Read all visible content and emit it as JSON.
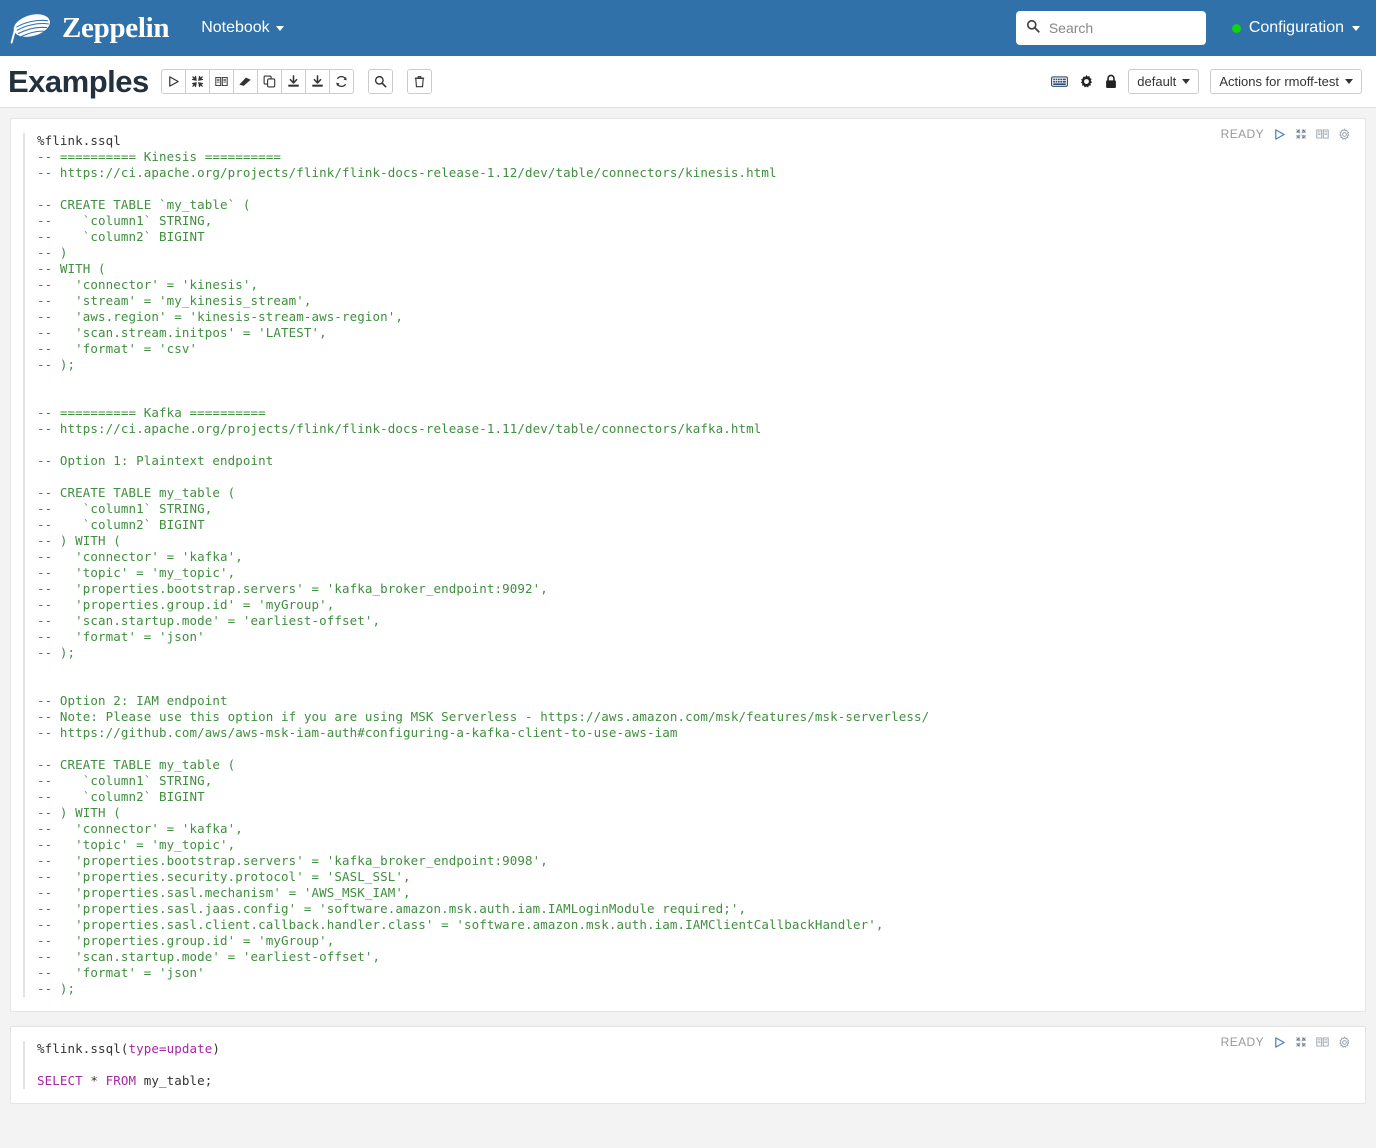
{
  "navbar": {
    "brand_name": "Zeppelin",
    "brand_logo_icon": "zeppelin-logo-icon",
    "notebook_menu_label": "Notebook",
    "search": {
      "placeholder": "Search",
      "value": "",
      "icon": "search-icon"
    },
    "configuration_label": "Configuration",
    "status_dot_color": "#0fd40f",
    "background_color": "#3071a9"
  },
  "note_toolbar": {
    "title": "Examples",
    "buttons": [
      {
        "name": "run-all-paragraphs-button",
        "icon": "play-icon",
        "title": "Run all paragraphs"
      },
      {
        "name": "toggle-all-collapse-button",
        "icon": "collapse-icon",
        "title": "Show/hide the code"
      },
      {
        "name": "toggle-all-output-button",
        "icon": "book-icon",
        "title": "Show/hide the output"
      },
      {
        "name": "clear-output-button",
        "icon": "eraser-icon",
        "title": "Clear output"
      },
      {
        "name": "clone-note-button",
        "icon": "copy-icon",
        "title": "Clone the notebook"
      },
      {
        "name": "export-note-button",
        "icon": "download-icon",
        "title": "Export the notebook"
      },
      {
        "name": "import-note-button",
        "icon": "download-alt-icon",
        "title": "Import the notebook"
      },
      {
        "name": "reload-note-button",
        "icon": "refresh-icon",
        "title": "Reload from storage"
      }
    ],
    "search_button": {
      "name": "search-code-button",
      "icon": "search-icon"
    },
    "trash_button": {
      "name": "move-to-trash-button",
      "icon": "trash-icon"
    },
    "keyboard_icon": "keyboard-icon",
    "settings_icon": "gear-icon",
    "lock_icon": "lock-icon",
    "interpreter_binding_label": "default",
    "actions_label": "Actions for rmoff-test"
  },
  "paragraphs": [
    {
      "id": "paragraph-1",
      "status": "READY",
      "controls": [
        {
          "name": "run-paragraph-button",
          "icon": "play-icon"
        },
        {
          "name": "hide-editor-button",
          "icon": "collapse-icon"
        },
        {
          "name": "hide-output-button",
          "icon": "book-icon"
        },
        {
          "name": "paragraph-settings-button",
          "icon": "gear-icon"
        }
      ],
      "code_lines": [
        [
          {
            "t": "%flink.ssql",
            "c": "par"
          }
        ],
        [
          {
            "t": "-- ========== Kinesis ==========",
            "c": "cmt"
          }
        ],
        [
          {
            "t": "-- https://ci.apache.org/projects/flink/flink-docs-release-1.12/dev/table/connectors/kinesis.html",
            "c": "cmt"
          }
        ],
        [
          {
            "t": "",
            "c": "par"
          }
        ],
        [
          {
            "t": "-- CREATE TABLE `my_table` (",
            "c": "cmt"
          }
        ],
        [
          {
            "t": "--    `column1` STRING,",
            "c": "cmt"
          }
        ],
        [
          {
            "t": "--    `column2` BIGINT",
            "c": "cmt"
          }
        ],
        [
          {
            "t": "-- )",
            "c": "cmt"
          }
        ],
        [
          {
            "t": "-- WITH (",
            "c": "cmt"
          }
        ],
        [
          {
            "t": "--   'connector' = 'kinesis',",
            "c": "cmt"
          }
        ],
        [
          {
            "t": "--   'stream' = 'my_kinesis_stream',",
            "c": "cmt"
          }
        ],
        [
          {
            "t": "--   'aws.region' = 'kinesis-stream-aws-region',",
            "c": "cmt"
          }
        ],
        [
          {
            "t": "--   'scan.stream.initpos' = 'LATEST',",
            "c": "cmt"
          }
        ],
        [
          {
            "t": "--   'format' = 'csv'",
            "c": "cmt"
          }
        ],
        [
          {
            "t": "-- );",
            "c": "cmt"
          }
        ],
        [
          {
            "t": "",
            "c": "par"
          }
        ],
        [
          {
            "t": "",
            "c": "par"
          }
        ],
        [
          {
            "t": "-- ========== Kafka ==========",
            "c": "cmt"
          }
        ],
        [
          {
            "t": "-- https://ci.apache.org/projects/flink/flink-docs-release-1.11/dev/table/connectors/kafka.html",
            "c": "cmt"
          }
        ],
        [
          {
            "t": "",
            "c": "par"
          }
        ],
        [
          {
            "t": "-- Option 1: Plaintext endpoint",
            "c": "cmt"
          }
        ],
        [
          {
            "t": "",
            "c": "par"
          }
        ],
        [
          {
            "t": "-- CREATE TABLE my_table (",
            "c": "cmt"
          }
        ],
        [
          {
            "t": "--    `column1` STRING,",
            "c": "cmt"
          }
        ],
        [
          {
            "t": "--    `column2` BIGINT",
            "c": "cmt"
          }
        ],
        [
          {
            "t": "-- ) WITH (",
            "c": "cmt"
          }
        ],
        [
          {
            "t": "--   'connector' = 'kafka',",
            "c": "cmt"
          }
        ],
        [
          {
            "t": "--   'topic' = 'my_topic',",
            "c": "cmt"
          }
        ],
        [
          {
            "t": "--   'properties.bootstrap.servers' = 'kafka_broker_endpoint:9092',",
            "c": "cmt"
          }
        ],
        [
          {
            "t": "--   'properties.group.id' = 'myGroup',",
            "c": "cmt"
          }
        ],
        [
          {
            "t": "--   'scan.startup.mode' = 'earliest-offset',",
            "c": "cmt"
          }
        ],
        [
          {
            "t": "--   'format' = 'json'",
            "c": "cmt"
          }
        ],
        [
          {
            "t": "-- );",
            "c": "cmt"
          }
        ],
        [
          {
            "t": "",
            "c": "par"
          }
        ],
        [
          {
            "t": "",
            "c": "par"
          }
        ],
        [
          {
            "t": "-- Option 2: IAM endpoint",
            "c": "cmt"
          }
        ],
        [
          {
            "t": "-- Note: Please use this option if you are using MSK Serverless - https://aws.amazon.com/msk/features/msk-serverless/",
            "c": "cmt"
          }
        ],
        [
          {
            "t": "-- https://github.com/aws/aws-msk-iam-auth#configuring-a-kafka-client-to-use-aws-iam",
            "c": "cmt"
          }
        ],
        [
          {
            "t": "",
            "c": "par"
          }
        ],
        [
          {
            "t": "-- CREATE TABLE my_table (",
            "c": "cmt"
          }
        ],
        [
          {
            "t": "--    `column1` STRING,",
            "c": "cmt"
          }
        ],
        [
          {
            "t": "--    `column2` BIGINT",
            "c": "cmt"
          }
        ],
        [
          {
            "t": "-- ) WITH (",
            "c": "cmt"
          }
        ],
        [
          {
            "t": "--   'connector' = 'kafka',",
            "c": "cmt"
          }
        ],
        [
          {
            "t": "--   'topic' = 'my_topic',",
            "c": "cmt"
          }
        ],
        [
          {
            "t": "--   'properties.bootstrap.servers' = 'kafka_broker_endpoint:9098',",
            "c": "cmt"
          }
        ],
        [
          {
            "t": "--   'properties.security.protocol' = 'SASL_SSL',",
            "c": "cmt"
          }
        ],
        [
          {
            "t": "--   'properties.sasl.mechanism' = 'AWS_MSK_IAM',",
            "c": "cmt"
          }
        ],
        [
          {
            "t": "--   'properties.sasl.jaas.config' = 'software.amazon.msk.auth.iam.IAMLoginModule required;',",
            "c": "cmt"
          }
        ],
        [
          {
            "t": "--   'properties.sasl.client.callback.handler.class' = 'software.amazon.msk.auth.iam.IAMClientCallbackHandler',",
            "c": "cmt"
          }
        ],
        [
          {
            "t": "--   'properties.group.id' = 'myGroup',",
            "c": "cmt"
          }
        ],
        [
          {
            "t": "--   'scan.startup.mode' = 'earliest-offset',",
            "c": "cmt"
          }
        ],
        [
          {
            "t": "--   'format' = 'json'",
            "c": "cmt"
          }
        ],
        [
          {
            "t": "-- );",
            "c": "cmt"
          }
        ]
      ]
    },
    {
      "id": "paragraph-2",
      "status": "READY",
      "controls": [
        {
          "name": "run-paragraph-button",
          "icon": "play-icon"
        },
        {
          "name": "hide-editor-button",
          "icon": "collapse-icon"
        },
        {
          "name": "hide-output-button",
          "icon": "book-icon"
        },
        {
          "name": "paragraph-settings-button",
          "icon": "gear-icon"
        }
      ],
      "code_lines": [
        [
          {
            "t": "%flink.ssql(",
            "c": "par"
          },
          {
            "t": "type=update",
            "c": "kw"
          },
          {
            "t": ")",
            "c": "par"
          }
        ],
        [
          {
            "t": "",
            "c": "par"
          }
        ],
        [
          {
            "t": "SELECT",
            "c": "kw"
          },
          {
            "t": " * ",
            "c": "par"
          },
          {
            "t": "FROM",
            "c": "kw"
          },
          {
            "t": " my_table;",
            "c": "par"
          }
        ]
      ]
    }
  ],
  "colors": {
    "navbar_blue": "#3071a9",
    "comment_green": "#3f8f3f",
    "keyword_purple": "#a626a4",
    "page_background": "#f3f3f3"
  }
}
